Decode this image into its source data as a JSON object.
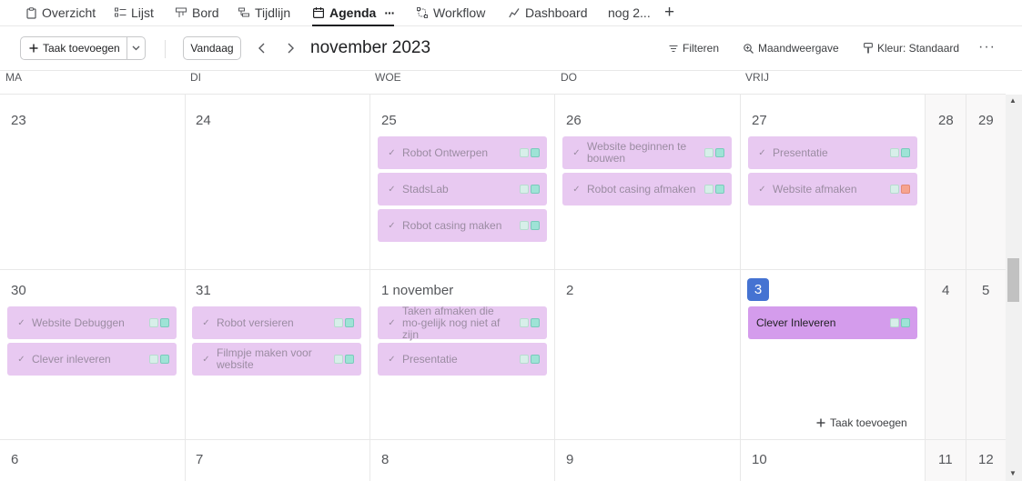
{
  "tabs": [
    {
      "label": "Overzicht",
      "icon": "clipboard-icon"
    },
    {
      "label": "Lijst",
      "icon": "list-icon"
    },
    {
      "label": "Bord",
      "icon": "board-icon"
    },
    {
      "label": "Tijdlijn",
      "icon": "timeline-icon"
    },
    {
      "label": "Agenda",
      "icon": "calendar-icon",
      "active": true,
      "more": "···"
    },
    {
      "label": "Workflow",
      "icon": "workflow-icon"
    },
    {
      "label": "Dashboard",
      "icon": "dashboard-icon"
    },
    {
      "label": "nog 2...",
      "icon": ""
    }
  ],
  "tab_add": "+",
  "toolbar": {
    "add_task": "Taak toevoegen",
    "today": "Vandaag",
    "month": "november 2023",
    "filter": "Filteren",
    "view": "Maandweergave",
    "color": "Kleur: Standaard",
    "more": "···"
  },
  "weekdays": [
    "MA",
    "DI",
    "WOE",
    "DO",
    "VRIJ"
  ],
  "weeks": [
    {
      "days": [
        "23",
        "24",
        "25",
        "26",
        "27",
        "28",
        "29"
      ]
    },
    {
      "days": [
        "30",
        "31",
        "1 november",
        "2",
        "3",
        "4",
        "5"
      ]
    },
    {
      "days": [
        "6",
        "7",
        "8",
        "9",
        "10",
        "11",
        "12"
      ]
    }
  ],
  "tasks": {
    "w1_woe_1": "Robot Ontwerpen",
    "w1_woe_2": "StadsLab",
    "w1_woe_3": "Robot casing maken",
    "w1_do_1": "Website beginnen te bouwen",
    "w1_do_2": "Robot casing afmaken",
    "w1_vrij_1": "Presentatie",
    "w1_vrij_2": "Website afmaken",
    "w2_ma_1": "Website Debuggen",
    "w2_ma_2": "Clever inleveren",
    "w2_di_1": "Robot versieren",
    "w2_di_2": "Filmpje maken voor website",
    "w2_woe_1": "Taken afmaken die mo-gelijk nog niet af zijn",
    "w2_woe_2": "Presentatie",
    "w2_vrij_1": "Clever Inleveren"
  },
  "add_task_cell": "Taak toevoegen",
  "colors": {
    "task": "#e8c9f1",
    "task_selected": "#d49cec",
    "today": "#4573d2"
  }
}
